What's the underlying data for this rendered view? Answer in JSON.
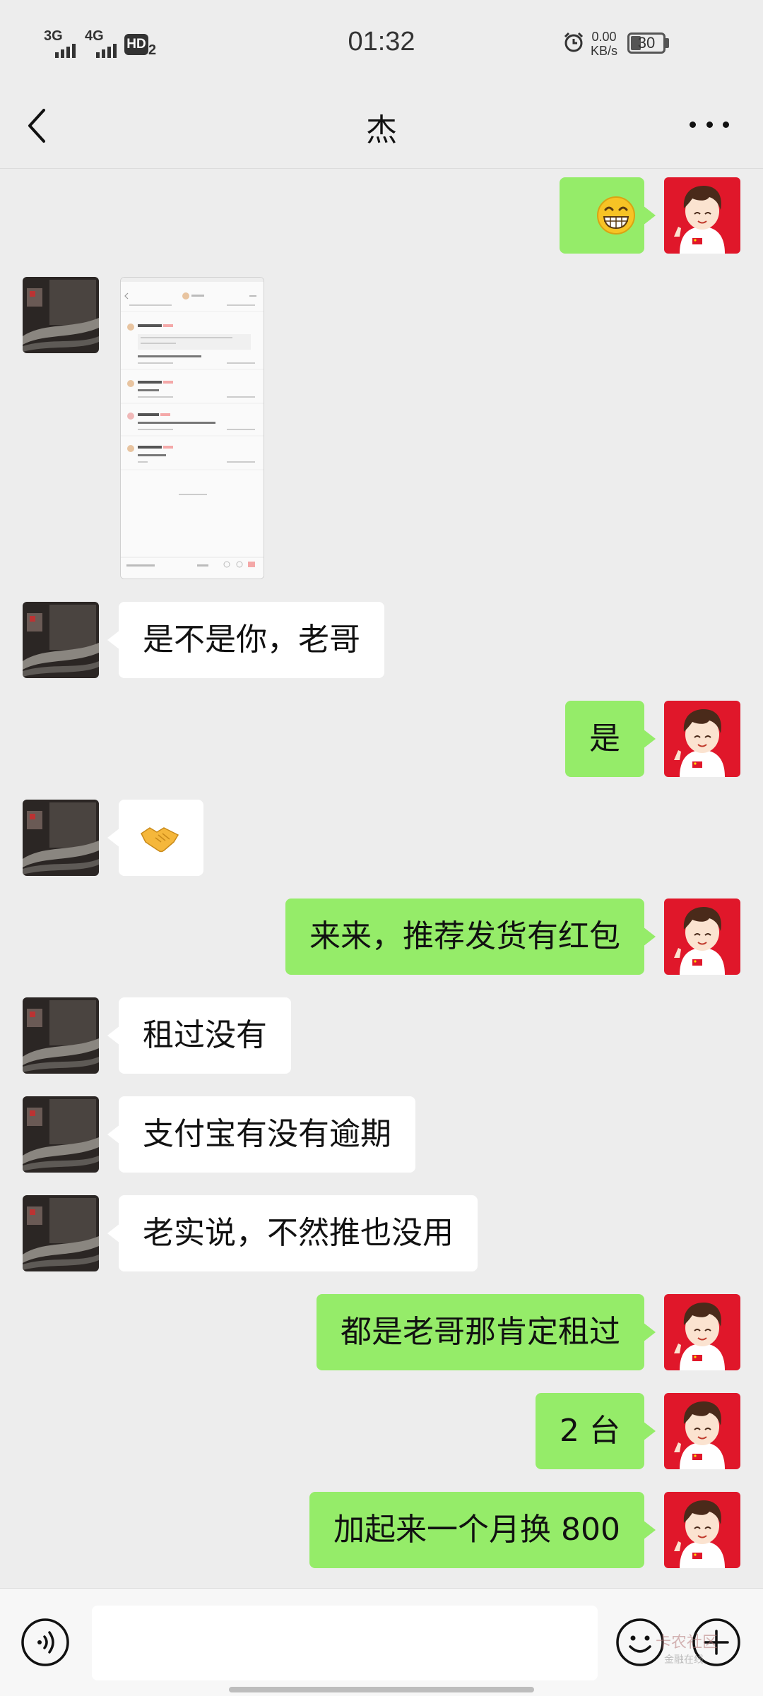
{
  "status_bar": {
    "network1": "3G",
    "network2": "4G",
    "hd_label": "HD",
    "hd_sub": "2",
    "time": "01:32",
    "speed_value": "0.00",
    "speed_unit": "KB/s",
    "battery": "30"
  },
  "header": {
    "title": "杰"
  },
  "messages": [
    {
      "from": "me",
      "type": "emoji",
      "icon": "grinning-face-emoji"
    },
    {
      "from": "other",
      "type": "image",
      "icon": "chat-screenshot-thumbnail"
    },
    {
      "from": "other",
      "type": "text",
      "text": "是不是你，老哥"
    },
    {
      "from": "me",
      "type": "text",
      "text": "是"
    },
    {
      "from": "other",
      "type": "emoji",
      "icon": "handshake-emoji"
    },
    {
      "from": "me",
      "type": "text",
      "text": "来来，推荐发货有红包"
    },
    {
      "from": "other",
      "type": "text",
      "text": "租过没有"
    },
    {
      "from": "other",
      "type": "text",
      "text": "支付宝有没有逾期"
    },
    {
      "from": "other",
      "type": "text",
      "text": "老实说，不然推也没用"
    },
    {
      "from": "me",
      "type": "text",
      "text": "都是老哥那肯定租过"
    },
    {
      "from": "me",
      "type": "text",
      "text": "2 台"
    },
    {
      "from": "me",
      "type": "text",
      "text": "加起来一个月换 800"
    }
  ],
  "input_bar": {
    "voice_icon": "voice-icon",
    "emoji_icon": "emoji-icon",
    "plus_icon": "plus-icon",
    "watermark_text": "卡农社区",
    "watermark_sub": "金融在线"
  },
  "colors": {
    "background": "#ededed",
    "my_bubble": "#95ec69",
    "other_bubble": "#ffffff",
    "my_avatar_bg": "#e0172a"
  }
}
